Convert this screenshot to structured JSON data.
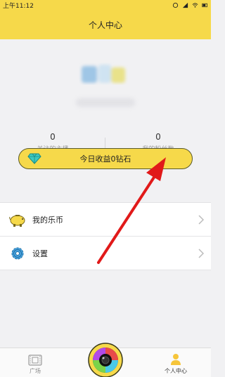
{
  "status_bar": {
    "time": "上午11:12"
  },
  "header": {
    "title": "个人中心"
  },
  "stats": [
    {
      "count": "0",
      "label": "关注的主播"
    },
    {
      "count": "0",
      "label": "我的粉丝数"
    }
  ],
  "earnings_button": {
    "label": "今日收益0钻石"
  },
  "menu": [
    {
      "label": "我的乐币",
      "icon": "piggy-bank-icon"
    },
    {
      "label": "设置",
      "icon": "gear-icon"
    }
  ],
  "tabs": [
    {
      "label": "广场",
      "icon": "film-icon",
      "active": false
    },
    {
      "label": "",
      "icon": "camera-lens-icon",
      "active": false
    },
    {
      "label": "个人中心",
      "icon": "person-icon",
      "active": true
    }
  ],
  "colors": {
    "accent": "#f6d94a",
    "annotation_arrow": "#e11919"
  }
}
